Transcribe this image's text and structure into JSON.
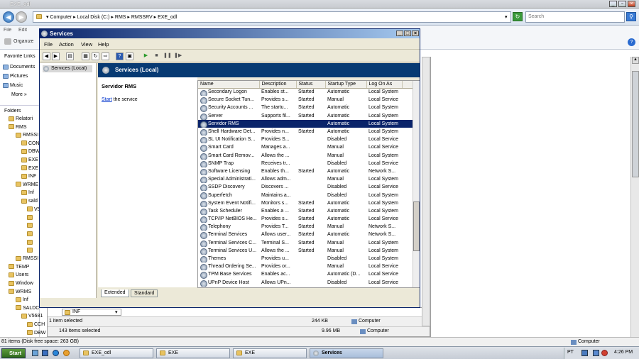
{
  "explorer": {
    "title": "EXE_odl",
    "breadcrumb": "▾  Computer  ▸  Local Disk (C:)  ▸  RMS  ▸  RMSSRV  ▸  EXE_odl",
    "search_placeholder": "Search",
    "menu_file": "File",
    "menu_edit": "Edit",
    "organize": "Organize",
    "favorite_links": "Favorite Links",
    "favorites": [
      "Documents",
      "Pictures",
      "Music",
      "More  »"
    ],
    "folders_label": "Folders",
    "tree": [
      "Relatori",
      "RMS",
      "RMSSI",
      "CON",
      "DBW",
      "EXE",
      "EXE",
      "INF",
      "WRME",
      "Inf",
      "sald",
      "V5",
      "",
      "",
      "",
      "",
      "",
      "RMSSI",
      "TEMP",
      "Users",
      "Window",
      "WRMS",
      "Inf",
      "SALDC",
      "V5681",
      "CCH",
      "DBW"
    ],
    "status_items": "81 items (Disk free space: 263 GB)",
    "status_computer": "Computer",
    "inner_folder_name": "INF",
    "inner_status1": "1 item selected",
    "inner_size1": "244 KB",
    "inner_computer1": "Computer",
    "inner_status2": "143 items selected",
    "inner_size2": "9.96 MB",
    "inner_computer2": "Computer"
  },
  "services_window": {
    "title": "Services",
    "menu": [
      "File",
      "Action",
      "View",
      "Help"
    ],
    "tree_item": "Services (Local)",
    "header": "Services (Local)",
    "selected_service": "Servidor RMS",
    "start_link": "Start",
    "start_suffix": " the service",
    "columns": [
      "Name",
      "Description",
      "Status",
      "Startup Type",
      "Log On As"
    ],
    "rows": [
      [
        "Secondary Logon",
        "Enables st...",
        "Started",
        "Automatic",
        "Local System"
      ],
      [
        "Secure Socket Tun...",
        "Provides s...",
        "Started",
        "Manual",
        "Local Service"
      ],
      [
        "Security Accounts ...",
        "The startu...",
        "Started",
        "Automatic",
        "Local System"
      ],
      [
        "Server",
        "Supports fil...",
        "Started",
        "Automatic",
        "Local System"
      ],
      [
        "Servidor RMS",
        "",
        "",
        "Automatic",
        "Local System"
      ],
      [
        "Shell Hardware Det...",
        "Provides n...",
        "Started",
        "Automatic",
        "Local System"
      ],
      [
        "SL UI Notification S...",
        "Provides S...",
        "",
        "Disabled",
        "Local Service"
      ],
      [
        "Smart Card",
        "Manages a...",
        "",
        "Manual",
        "Local Service"
      ],
      [
        "Smart Card Remov...",
        "Allows the ...",
        "",
        "Manual",
        "Local System"
      ],
      [
        "SNMP Trap",
        "Receives tr...",
        "",
        "Disabled",
        "Local Service"
      ],
      [
        "Software Licensing",
        "Enables th...",
        "Started",
        "Automatic",
        "Network S..."
      ],
      [
        "Special Administrati...",
        "Allows adm...",
        "",
        "Manual",
        "Local System"
      ],
      [
        "SSDP Discovery",
        "Discovers ...",
        "",
        "Disabled",
        "Local Service"
      ],
      [
        "Superfetch",
        "Maintains a...",
        "",
        "Disabled",
        "Local System"
      ],
      [
        "System Event Notifi...",
        "Monitors s...",
        "Started",
        "Automatic",
        "Local System"
      ],
      [
        "Task Scheduler",
        "Enables a ...",
        "Started",
        "Automatic",
        "Local System"
      ],
      [
        "TCP/IP NetBIOS He...",
        "Provides s...",
        "Started",
        "Automatic",
        "Local Service"
      ],
      [
        "Telephony",
        "Provides T...",
        "Started",
        "Manual",
        "Network S..."
      ],
      [
        "Terminal Services",
        "Allows user...",
        "Started",
        "Automatic",
        "Network S..."
      ],
      [
        "Terminal Services C...",
        "Terminal S...",
        "Started",
        "Manual",
        "Local System"
      ],
      [
        "Terminal Services U...",
        "Allows the ...",
        "Started",
        "Manual",
        "Local System"
      ],
      [
        "Themes",
        "Provides u...",
        "",
        "Disabled",
        "Local System"
      ],
      [
        "Thread Ordering Se...",
        "Provides or...",
        "",
        "Manual",
        "Local Service"
      ],
      [
        "TPM Base Services",
        "Enables ac...",
        "",
        "Automatic (D...",
        "Local Service"
      ],
      [
        "UPnP Device Host",
        "Allows UPn...",
        "",
        "Disabled",
        "Local Service"
      ]
    ],
    "tabs": [
      "Extended",
      "Standard"
    ]
  },
  "taskbar": {
    "start": "Start",
    "buttons": [
      "EXE_odl",
      "EXE",
      "EXE",
      "Services"
    ],
    "lang": "PT",
    "clock": "4:26 PM"
  },
  "colors": {
    "selection": "#0a246a",
    "header_bg": "#073a73"
  }
}
